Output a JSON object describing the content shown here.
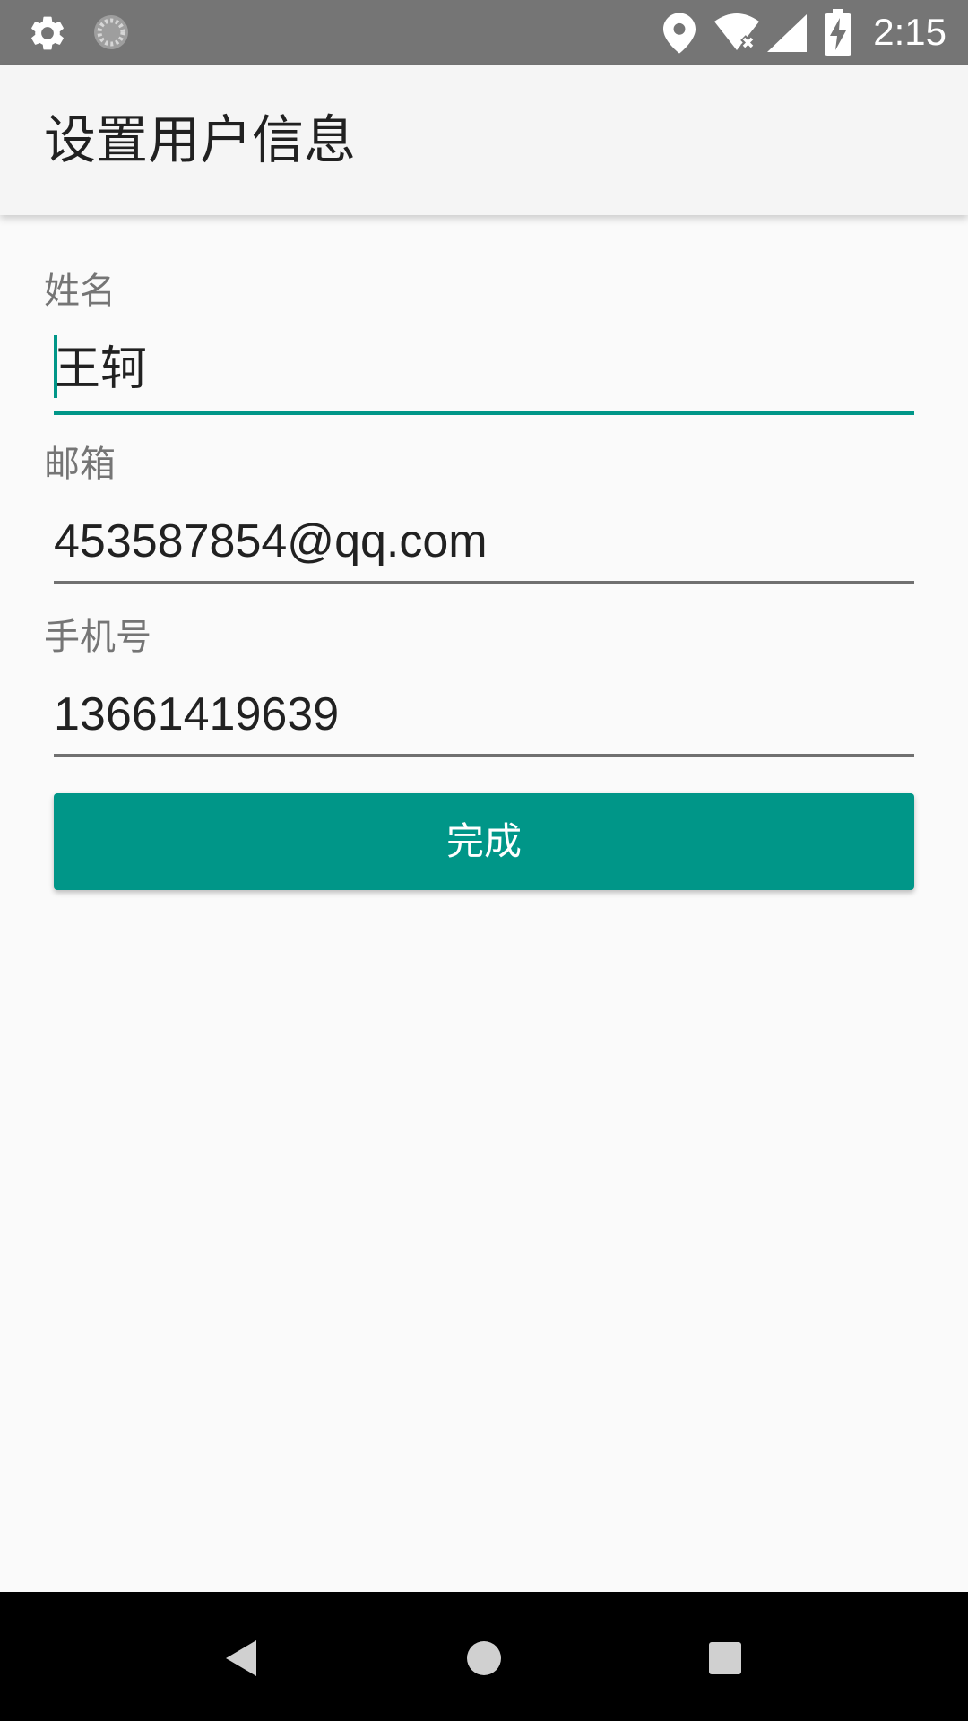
{
  "status_bar": {
    "time": "2:15",
    "icons": [
      "settings-icon",
      "sync-icon",
      "location-icon",
      "wifi-off-icon",
      "signal-icon",
      "battery-charging-icon"
    ]
  },
  "app_bar": {
    "title": "设置用户信息"
  },
  "form": {
    "name": {
      "label": "姓名",
      "value": "王轲"
    },
    "email": {
      "label": "邮箱",
      "value": "453587854@qq.com"
    },
    "phone": {
      "label": "手机号",
      "value": "13661419639"
    },
    "submit_label": "完成"
  },
  "nav_bar": {
    "icons": [
      "back-icon",
      "home-icon",
      "recents-icon"
    ]
  },
  "colors": {
    "accent": "#009688",
    "status_bar": "#757575",
    "app_bar": "#f5f5f5",
    "background": "#fafafa",
    "nav_bar": "#000000"
  }
}
